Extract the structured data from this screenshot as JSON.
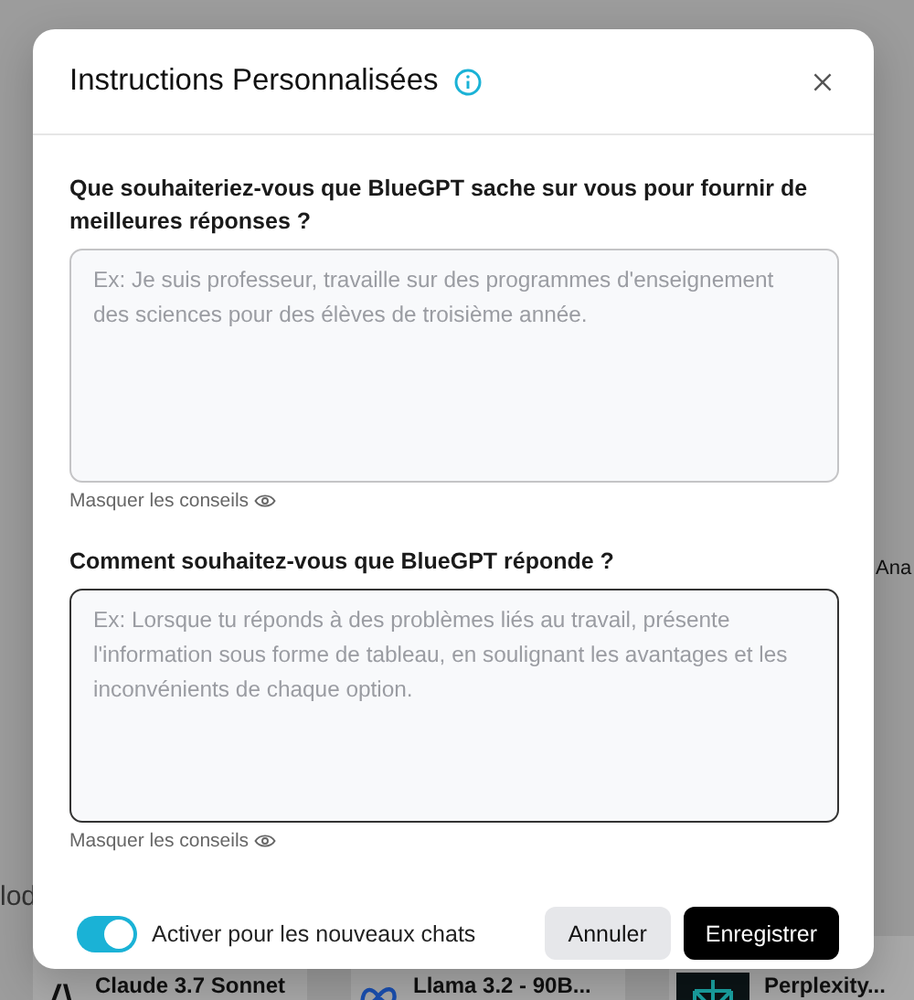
{
  "background": {
    "tab_fragment": "Ana",
    "section_fragment": "lod",
    "models": [
      {
        "name": "Claude 3.7 Sonnet",
        "kind": "slash"
      },
      {
        "name": "Llama 3.2 - 90B...",
        "kind": "loop"
      },
      {
        "name": "Perplexity...",
        "kind": "grid"
      }
    ]
  },
  "dialog": {
    "title": "Instructions Personnalisées",
    "fields": [
      {
        "label": "Que souhaiteriez-vous que BlueGPT sache sur vous pour fournir de meilleures réponses ?",
        "placeholder": "Ex: Je suis professeur, travaille sur des programmes d'enseignement des sciences pour des élèves de troisième année.",
        "hint": "Masquer les conseils",
        "focused": false
      },
      {
        "label": "Comment souhaitez-vous que BlueGPT réponde ?",
        "placeholder": "Ex: Lorsque tu réponds à des problèmes liés au travail, présente l'information sous forme de tableau, en soulignant les avantages et les inconvénients de chaque option.",
        "hint": "Masquer les conseils",
        "focused": true
      }
    ],
    "toggle": {
      "label": "Activer pour les nouveaux chats",
      "on": true
    },
    "buttons": [
      {
        "label": "Annuler",
        "kind": "secondary"
      },
      {
        "label": "Enregistrer",
        "kind": "primary"
      }
    ]
  }
}
